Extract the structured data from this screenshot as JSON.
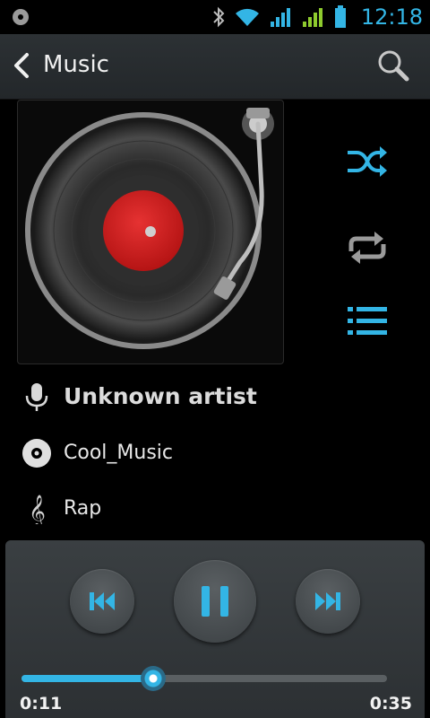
{
  "status_bar": {
    "time": "12:18",
    "icons": [
      "notification-icon",
      "bluetooth-icon",
      "wifi-icon",
      "signal-icon",
      "signal-icon",
      "battery-icon"
    ],
    "accent_color": "#33b5e5",
    "signal_color": "#8ecb2e"
  },
  "action_bar": {
    "title": "Music",
    "back_icon": "chevron-left-icon",
    "search_icon": "search-icon"
  },
  "side_controls": {
    "shuffle_icon": "shuffle-icon",
    "shuffle_active": true,
    "repeat_icon": "repeat-icon",
    "repeat_active": false,
    "playlist_icon": "playlist-icon"
  },
  "track": {
    "artist": "Unknown artist",
    "album": "Cool_Music",
    "genre": "Rap"
  },
  "player": {
    "current_time": "0:11",
    "total_time": "0:35",
    "progress": 0.36,
    "state": "playing"
  }
}
